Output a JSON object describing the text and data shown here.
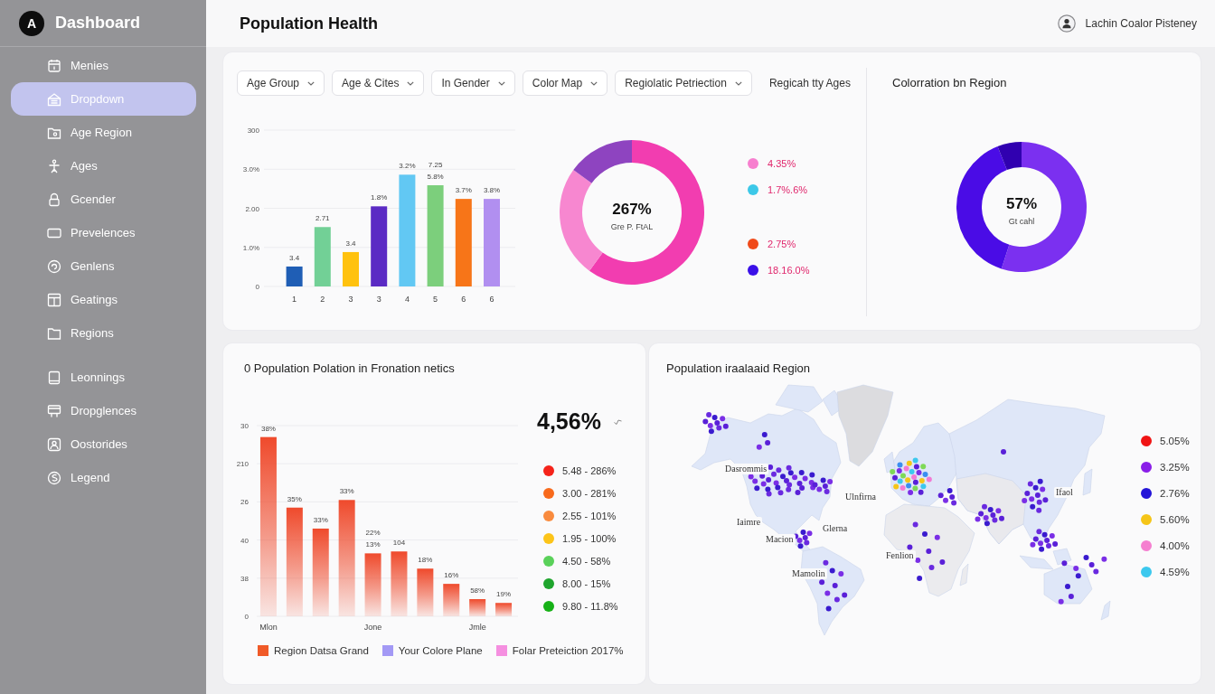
{
  "sidebar": {
    "logo_letter": "A",
    "title": "Dashboard",
    "sections": [
      {
        "items": [
          {
            "label": "Menies",
            "selected": false
          },
          {
            "label": "Dropdown",
            "selected": true
          },
          {
            "label": "Age Region",
            "selected": false
          },
          {
            "label": "Ages",
            "selected": false
          },
          {
            "label": "Gcender",
            "selected": false
          },
          {
            "label": "Prevelences",
            "selected": false
          },
          {
            "label": "Genlens",
            "selected": false
          },
          {
            "label": "Geatings",
            "selected": false
          },
          {
            "label": "Regions",
            "selected": false
          }
        ]
      },
      {
        "items": [
          {
            "label": "Leonnings",
            "selected": false
          },
          {
            "label": "Dropglences",
            "selected": false
          },
          {
            "label": "Oostorides",
            "selected": false
          },
          {
            "label": "Legend",
            "selected": false
          }
        ]
      }
    ]
  },
  "header": {
    "title": "Population Health",
    "user_name": "Lachin Coalor Pisteney"
  },
  "filters": {
    "dropdowns": [
      "Age Group",
      "Age & Cites",
      "In Gender",
      "Color Map",
      "Regiolatic Petriection"
    ],
    "caption": "Regicah tty Ages"
  },
  "age_chart": {
    "y_axis_top_label": "300",
    "chart_data": {
      "type": "bar",
      "categories": [
        "1",
        "2",
        "3",
        "3",
        "4",
        "5",
        "6",
        "6"
      ],
      "series": [
        {
          "values": [
            0.51,
            1.52,
            0.88,
            2.05,
            2.86,
            2.59,
            2.24,
            2.24
          ]
        }
      ],
      "colors": [
        "#1f5eb5",
        "#72d096",
        "#ffc20e",
        "#5b2bc4",
        "#62c8f3",
        "#7ccf7c",
        "#f77518",
        "#b18ff0"
      ],
      "ylim": [
        0,
        4
      ],
      "yticks": [
        {
          "value": 0,
          "label": "0"
        },
        {
          "value": 1,
          "label": "1.0%"
        },
        {
          "value": 2,
          "label": "2.00"
        },
        {
          "value": 3,
          "label": "3.0%"
        }
      ],
      "grid": true,
      "value_labels": [
        "3.4",
        "2.71",
        "3.4",
        "1.8%",
        "3.2%",
        "5.8%",
        "3.7%",
        "3.8%"
      ],
      "annotations": [
        "7.25"
      ]
    }
  },
  "share_donut": {
    "chart_data": {
      "type": "donut",
      "values": [
        60,
        25,
        15
      ],
      "colors": [
        "#f23db0",
        "#f787d0",
        "#8e44c0"
      ]
    },
    "center_value": "267%",
    "center_label": "Gre P. FtAL",
    "legend": [
      {
        "items": [
          {
            "color": "#f77fcf",
            "label": "4.35%"
          },
          {
            "color": "#3cc8e8",
            "label": "1.7%.6%"
          }
        ]
      },
      {
        "items": [
          {
            "color": "#f04a1a",
            "label": "2.75%"
          },
          {
            "color": "#3a10e8",
            "label": "18.16.0%"
          }
        ]
      }
    ]
  },
  "region_donut": {
    "title": "Colorration bn Region",
    "chart_data": {
      "type": "donut",
      "values": [
        55,
        39,
        6
      ],
      "colors": [
        "#7b30f0",
        "#4a0ce6",
        "#3000b0"
      ]
    },
    "center_value": "57%",
    "center_label": "Gt cahl"
  },
  "prevalence_panel": {
    "title": "0 Population Polation in Fronation netics",
    "bar_picture": {
      "y_axis_labels": [
        "30",
        "210",
        "26",
        "40",
        "38",
        "0"
      ],
      "bar_labels": [
        [
          "38%"
        ],
        [
          "35%"
        ],
        [
          "33%"
        ],
        [
          "33%"
        ],
        [
          "22%",
          "13%"
        ],
        [
          "104"
        ],
        [
          "18%"
        ],
        [
          "16%"
        ],
        [
          "58%"
        ],
        [
          "19%"
        ]
      ],
      "x_labels": [
        "Mlon",
        "Jone",
        "Jmle"
      ]
    },
    "headline": "4,56%",
    "range_legend": [
      {
        "color": "#f5231a",
        "label": "5.48 - 286%"
      },
      {
        "color": "#f86a1c",
        "label": "3.00 - 281%"
      },
      {
        "color": "#f98b3e",
        "label": "2.55 - 101%"
      },
      {
        "color": "#fcc419",
        "label": "1.95 - 100%"
      },
      {
        "color": "#5ad15a",
        "label": "4.50 - 58%"
      },
      {
        "color": "#1fa52e",
        "label": "8.00 - 15%"
      },
      {
        "color": "#17b117",
        "label": "9.80 - 11.8%"
      }
    ],
    "series_legend": [
      {
        "color": "#f05a28",
        "label": "Region Datsa Grand"
      },
      {
        "color": "#a399f5",
        "label": "Your Colore Plane"
      },
      {
        "color": "#f58fe0",
        "label": "Folar Preteiction 2017%"
      }
    ]
  },
  "map_panel": {
    "title": "Population iraalaaid Region",
    "place_labels": [
      "Dasrommis",
      "Ulnfirna",
      "Iaimre",
      "Glerna",
      "Macion",
      "Fenlion",
      "Mamolin",
      "Ifaol"
    ],
    "legend": [
      {
        "color": "#f01414",
        "label": "5.05%"
      },
      {
        "color": "#8a1ee8",
        "label": "3.25%"
      },
      {
        "color": "#2414d8",
        "label": "2.76%"
      },
      {
        "color": "#f5c518",
        "label": "5.60%"
      },
      {
        "color": "#f57fd0",
        "label": "4.00%"
      },
      {
        "color": "#3cc8ee",
        "label": "4.59%"
      }
    ]
  }
}
